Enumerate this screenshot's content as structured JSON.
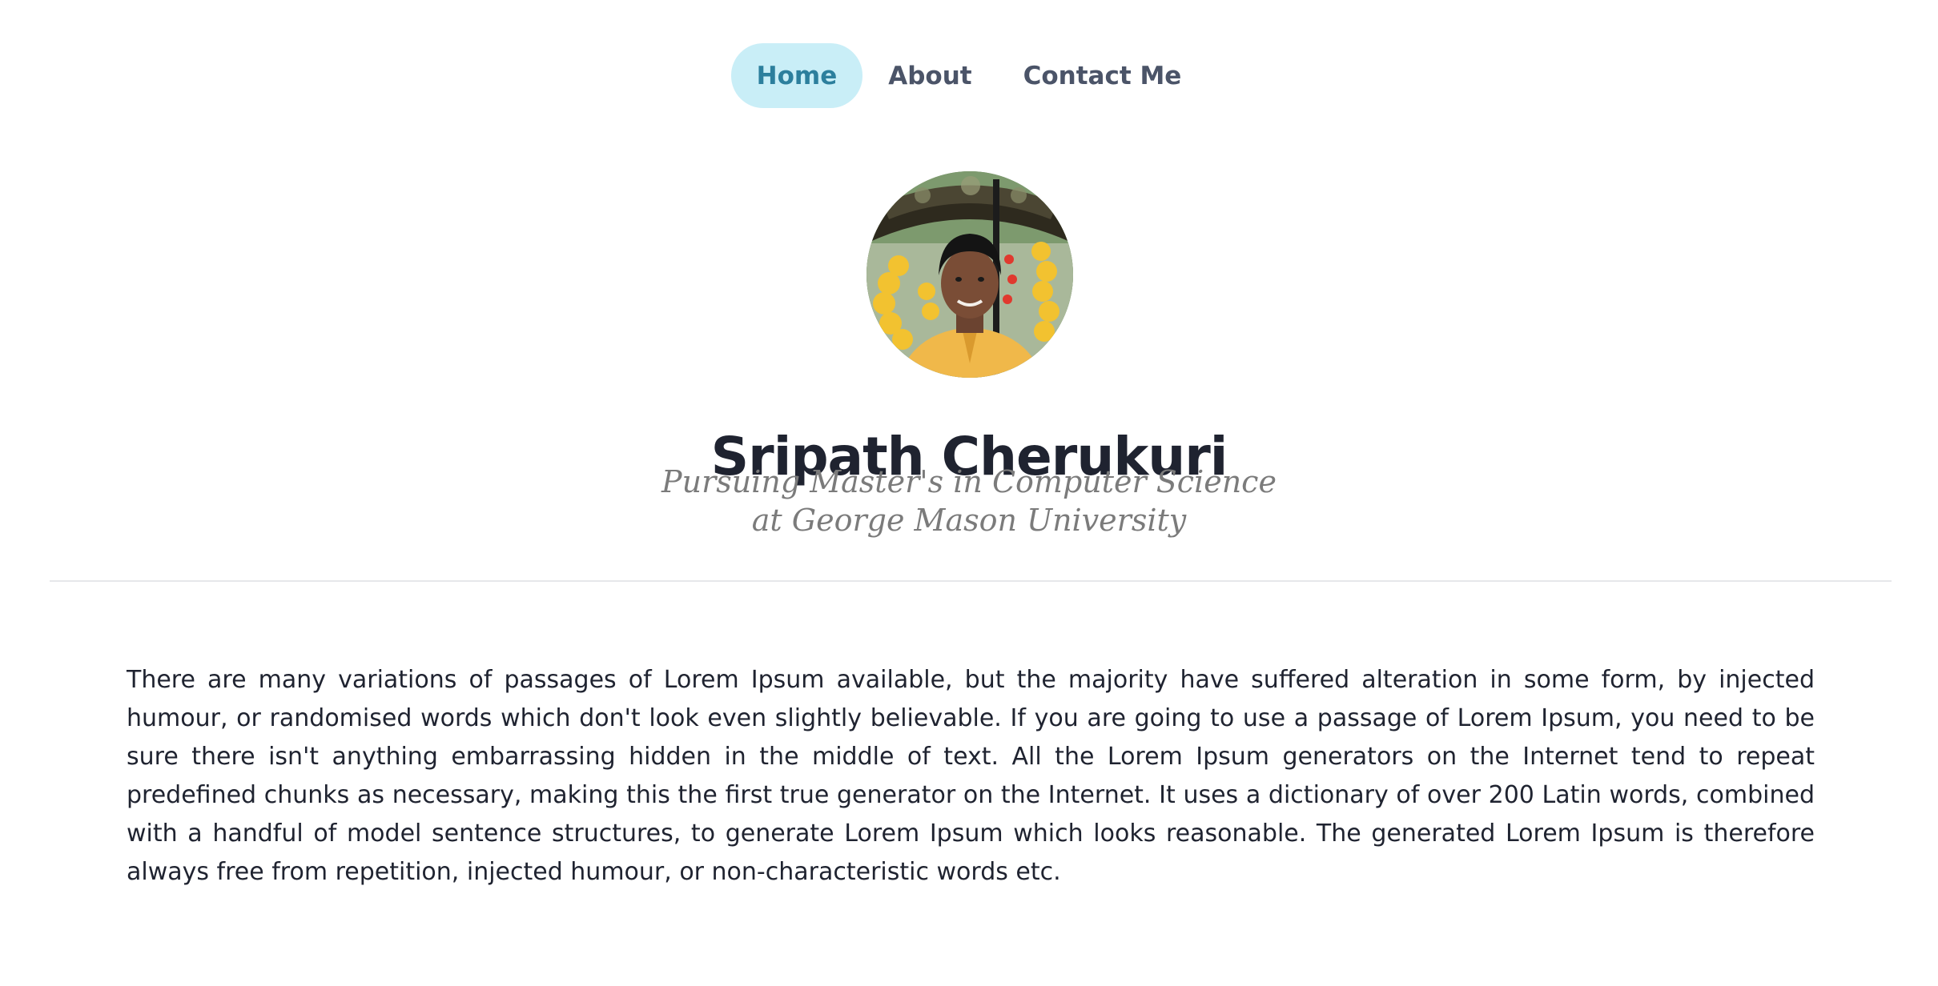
{
  "nav": {
    "items": [
      {
        "label": "Home",
        "active": true
      },
      {
        "label": "About",
        "active": false
      },
      {
        "label": "Contact Me",
        "active": false
      }
    ]
  },
  "profile": {
    "name": "Sripath Cherukuri",
    "subtitle_line1": "Pursuing Master's in Computer Science",
    "subtitle_line2": "at George Mason University"
  },
  "content": {
    "paragraph": "There are many variations of passages of Lorem Ipsum available, but the majority have suffered alteration in some form, by injected humour, or randomised words which don't look even slightly believable. If you are going to use a passage of Lorem Ipsum, you need to be sure there isn't anything embarrassing hidden in the middle of text. All the Lorem Ipsum generators on the Internet tend to repeat predefined chunks as necessary, making this the first true generator on the Internet. It uses a dictionary of over 200 Latin words, combined with a handful of model sentence structures, to generate Lorem Ipsum which looks reasonable. The generated Lorem Ipsum is therefore always free from repetition, injected humour, or non-characteristic words etc."
  },
  "colors": {
    "nav_active_bg": "#c9eef7",
    "nav_active_text": "#2c7f9d",
    "nav_text": "#4b5468",
    "heading": "#1f2330",
    "subtitle": "#7b7b7b",
    "divider": "#e6e7ea"
  }
}
